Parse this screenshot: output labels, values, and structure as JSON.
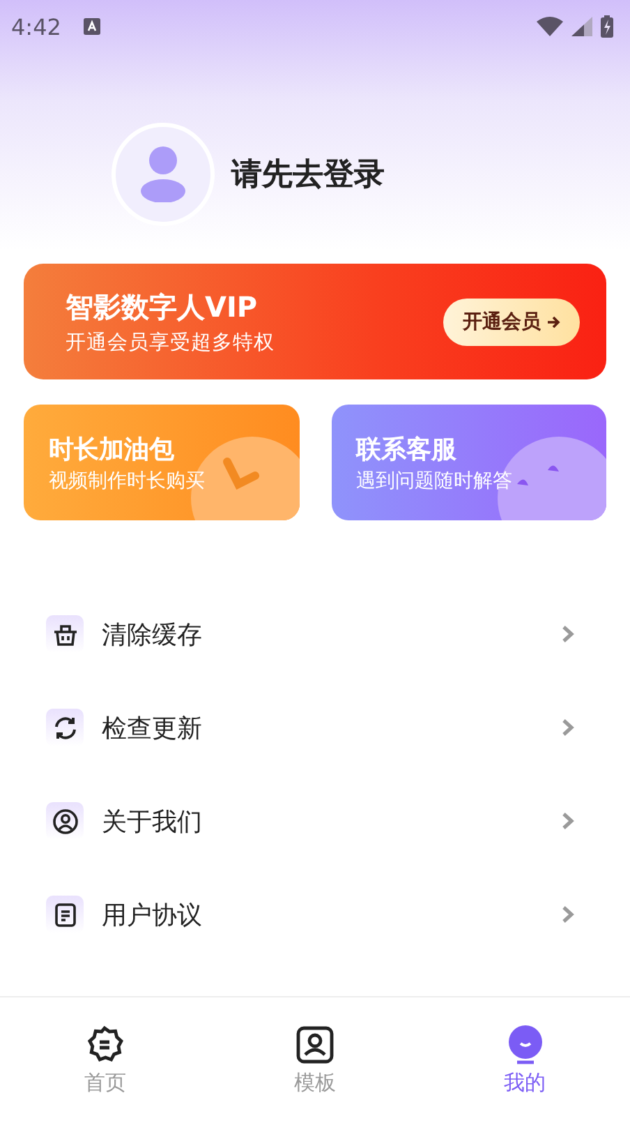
{
  "status_bar": {
    "time": "4:42"
  },
  "profile": {
    "login_prompt": "请先去登录"
  },
  "vip_card": {
    "title": "智影数字人VIP",
    "subtitle": "开通会员享受超多特权",
    "button": "开通会员"
  },
  "feature_cards": [
    {
      "kind": "time",
      "title": "时长加油包",
      "subtitle": "视频制作时长购买"
    },
    {
      "kind": "service",
      "title": "联系客服",
      "subtitle": "遇到问题随时解答"
    }
  ],
  "menu": [
    {
      "kind": "cache",
      "label": "清除缓存"
    },
    {
      "kind": "update",
      "label": "检查更新"
    },
    {
      "kind": "about",
      "label": "关于我们"
    },
    {
      "kind": "agreement",
      "label": "用户协议"
    }
  ],
  "tab_bar": [
    {
      "kind": "home",
      "label": "首页",
      "selected": false
    },
    {
      "kind": "template",
      "label": "模板",
      "selected": false
    },
    {
      "kind": "mine",
      "label": "我的",
      "selected": true
    }
  ]
}
